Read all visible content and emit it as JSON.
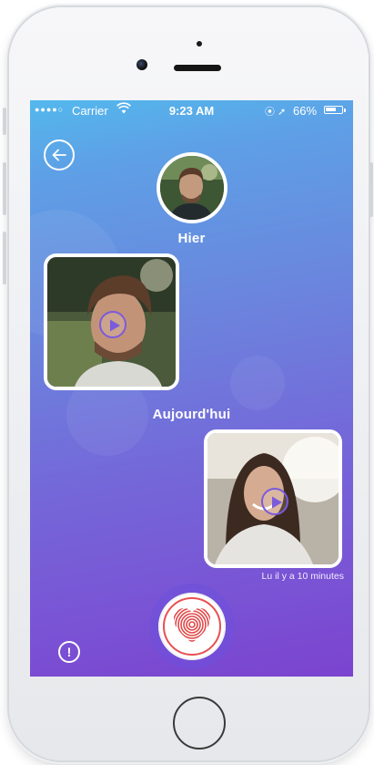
{
  "status_bar": {
    "signal": "●●●●○",
    "carrier": "Carrier",
    "wifi_icon": "wifi-icon",
    "time": "9:23 AM",
    "location_icon": "⦿ ➚",
    "battery_percent": "66%",
    "battery_level": 0.66
  },
  "nav": {
    "back_icon": "arrow-left-circle-icon"
  },
  "conversation": {
    "sections": [
      {
        "label": "Hier"
      },
      {
        "label": "Aujourd'hui"
      }
    ],
    "messages": [
      {
        "sender": "contact",
        "type": "video",
        "play_icon": "play-icon"
      },
      {
        "sender": "me",
        "type": "video",
        "play_icon": "play-icon",
        "read_status": "Lu il y a 10 minutes"
      }
    ]
  },
  "actions": {
    "record_icon": "fingerprint-heart-icon",
    "info_label": "!"
  },
  "colors": {
    "accent_red": "#e85050",
    "gradient_top": "#53b8ec",
    "gradient_bottom": "#7b43cf"
  }
}
